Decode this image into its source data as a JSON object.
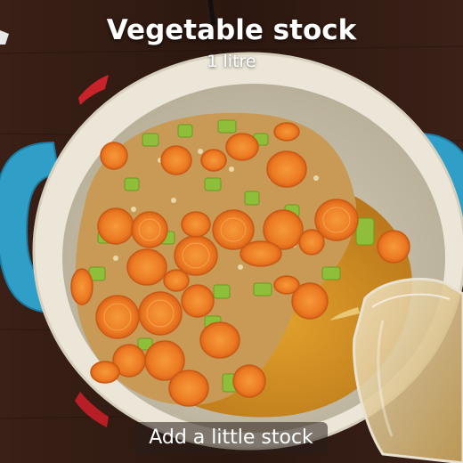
{
  "overlay": {
    "title": "Vegetable stock",
    "subtitle": "1 litre",
    "caption": "Add a little stock"
  },
  "colors": {
    "table": "#2e1a12",
    "pot_rim": "#e9e3d4",
    "pot_handle": "#2f9fc7",
    "pot_outer_red": "#c8222a",
    "broth": "#d9921e",
    "carrot": "#e8741f",
    "celery": "#8fbf3a"
  }
}
